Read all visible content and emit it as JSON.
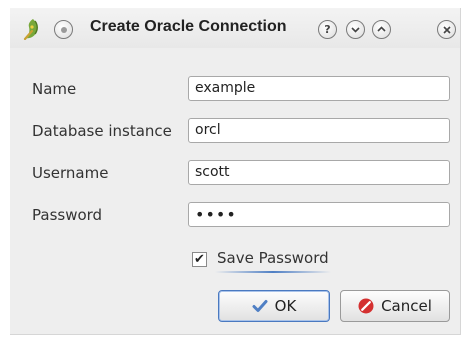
{
  "window": {
    "title": "Create Oracle Connection",
    "help_symbol": "?",
    "minimize_symbol": "⌄",
    "maximize_symbol": "⌃",
    "close_symbol": "✕"
  },
  "form": {
    "name": {
      "label": "Name",
      "value": "example"
    },
    "database_instance": {
      "label": "Database instance",
      "value": "orcl"
    },
    "username": {
      "label": "Username",
      "value": "scott"
    },
    "password": {
      "label": "Password",
      "value": "••••"
    }
  },
  "save_password": {
    "label": "Save Password",
    "checked": true,
    "mark": "✔"
  },
  "buttons": {
    "ok": {
      "label": "OK",
      "icon": "checkmark-icon",
      "color": "#4f7fc4"
    },
    "cancel": {
      "label": "Cancel",
      "icon": "cancel-icon",
      "color": "#d43030"
    }
  },
  "icons": {
    "app": "qgis-logo-icon",
    "window_menu": "window-menu-icon"
  }
}
